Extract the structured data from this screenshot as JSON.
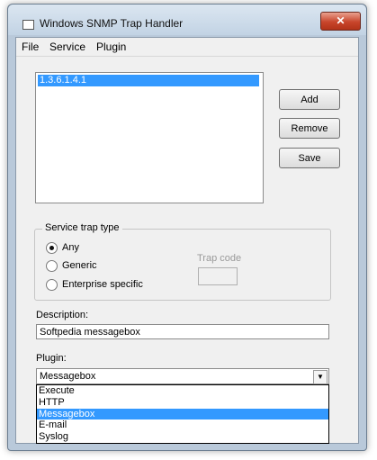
{
  "window": {
    "title": "Windows SNMP Trap Handler",
    "close_label": "✕"
  },
  "menu": [
    "File",
    "Service",
    "Plugin"
  ],
  "trap_list": {
    "items": [
      "1.3.6.1.4.1"
    ]
  },
  "buttons": {
    "add": "Add",
    "remove": "Remove",
    "save": "Save"
  },
  "service_trap_type": {
    "label": "Service trap type",
    "options": [
      "Any",
      "Generic",
      "Enterprise specific"
    ],
    "selected": "Any",
    "trap_code_label": "Trap code",
    "trap_code_value": ""
  },
  "description": {
    "label": "Description:",
    "value": "Softpedia messagebox"
  },
  "plugin": {
    "label": "Plugin:",
    "value": "Messagebox",
    "options": [
      "Execute",
      "HTTP",
      "Messagebox",
      "E-mail",
      "Syslog"
    ],
    "highlighted": "Messagebox"
  }
}
